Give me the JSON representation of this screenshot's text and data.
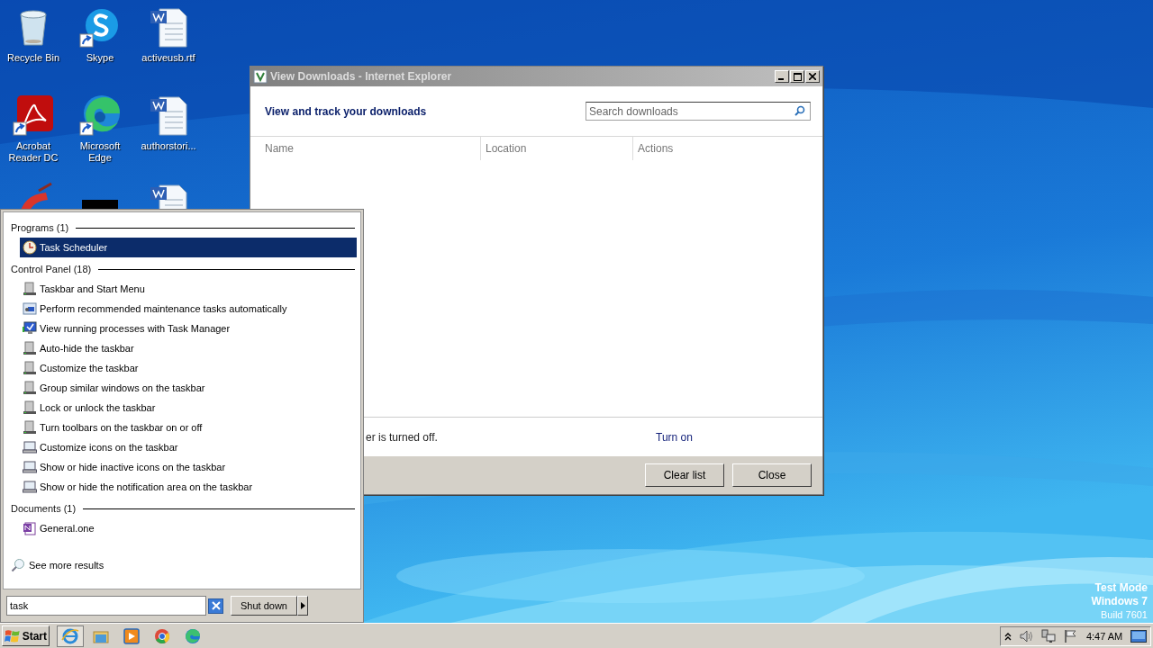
{
  "desktop_icons": [
    {
      "label": "Recycle Bin",
      "kind": "recycle",
      "shortcut": false
    },
    {
      "label": "Skype",
      "kind": "skype",
      "shortcut": true
    },
    {
      "label": "activeusb.rtf",
      "kind": "word",
      "shortcut": false
    },
    {
      "label": "Acrobat Reader DC",
      "kind": "acrobat",
      "shortcut": true
    },
    {
      "label": "Microsoft Edge",
      "kind": "edge",
      "shortcut": true
    },
    {
      "label": "authorstori...",
      "kind": "word",
      "shortcut": false
    },
    {
      "kind": "brush"
    },
    {
      "kind": "dark"
    },
    {
      "kind": "word"
    }
  ],
  "downloads_window": {
    "title": "View Downloads - Internet Explorer",
    "heading": "View and track your downloads",
    "search": {
      "placeholder": "Search downloads"
    },
    "columns": [
      "Name",
      "Location",
      "Actions"
    ],
    "notice": "er is turned off.",
    "notice_link": "Turn on",
    "buttons": [
      "Clear list",
      "Close"
    ]
  },
  "start_menu": {
    "groups": [
      {
        "title": "Programs (1)",
        "items": [
          {
            "label": "Task Scheduler",
            "kind": "clock",
            "selected": true
          }
        ]
      },
      {
        "title": "Control Panel (18)",
        "items": [
          {
            "label": "Taskbar and Start Menu",
            "kind": "taskbar",
            "selected": false
          },
          {
            "label": "Perform recommended maintenance tasks automatically",
            "kind": "maintenance",
            "selected": false
          },
          {
            "label": "View running processes with Task Manager",
            "kind": "taskmanager",
            "selected": false
          },
          {
            "label": "Auto-hide the taskbar",
            "kind": "taskbar",
            "selected": false
          },
          {
            "label": "Customize the taskbar",
            "kind": "taskbar",
            "selected": false
          },
          {
            "label": "Group similar windows on the taskbar",
            "kind": "taskbar",
            "selected": false
          },
          {
            "label": "Lock or unlock the taskbar",
            "kind": "taskbar",
            "selected": false
          },
          {
            "label": "Turn toolbars on the taskbar on or off",
            "kind": "taskbar",
            "selected": false
          },
          {
            "label": "Customize icons on the taskbar",
            "kind": "notification",
            "selected": false
          },
          {
            "label": "Show or hide inactive icons on the taskbar",
            "kind": "notification",
            "selected": false
          },
          {
            "label": "Show or hide the notification area on the taskbar",
            "kind": "notification",
            "selected": false
          }
        ]
      },
      {
        "title": "Documents (1)",
        "items": [
          {
            "label": "General.one",
            "kind": "onenote",
            "selected": false
          }
        ]
      }
    ],
    "see_more": "See more results",
    "search": {
      "value": "task"
    },
    "shut_down": "Shut down"
  },
  "desktop_text": [
    {
      "text": "Test Mode",
      "bold": true
    },
    {
      "text": "Windows 7",
      "bold": true
    },
    {
      "text": "Build 7601",
      "bold": false
    }
  ],
  "taskbar": {
    "start": "Start",
    "apps": [
      {
        "kind": "ie",
        "active": true
      },
      {
        "kind": "explorer",
        "active": false
      },
      {
        "kind": "media",
        "active": false
      },
      {
        "kind": "chrome",
        "active": false
      },
      {
        "kind": "edge",
        "active": false
      }
    ],
    "time": "4:47 AM"
  }
}
